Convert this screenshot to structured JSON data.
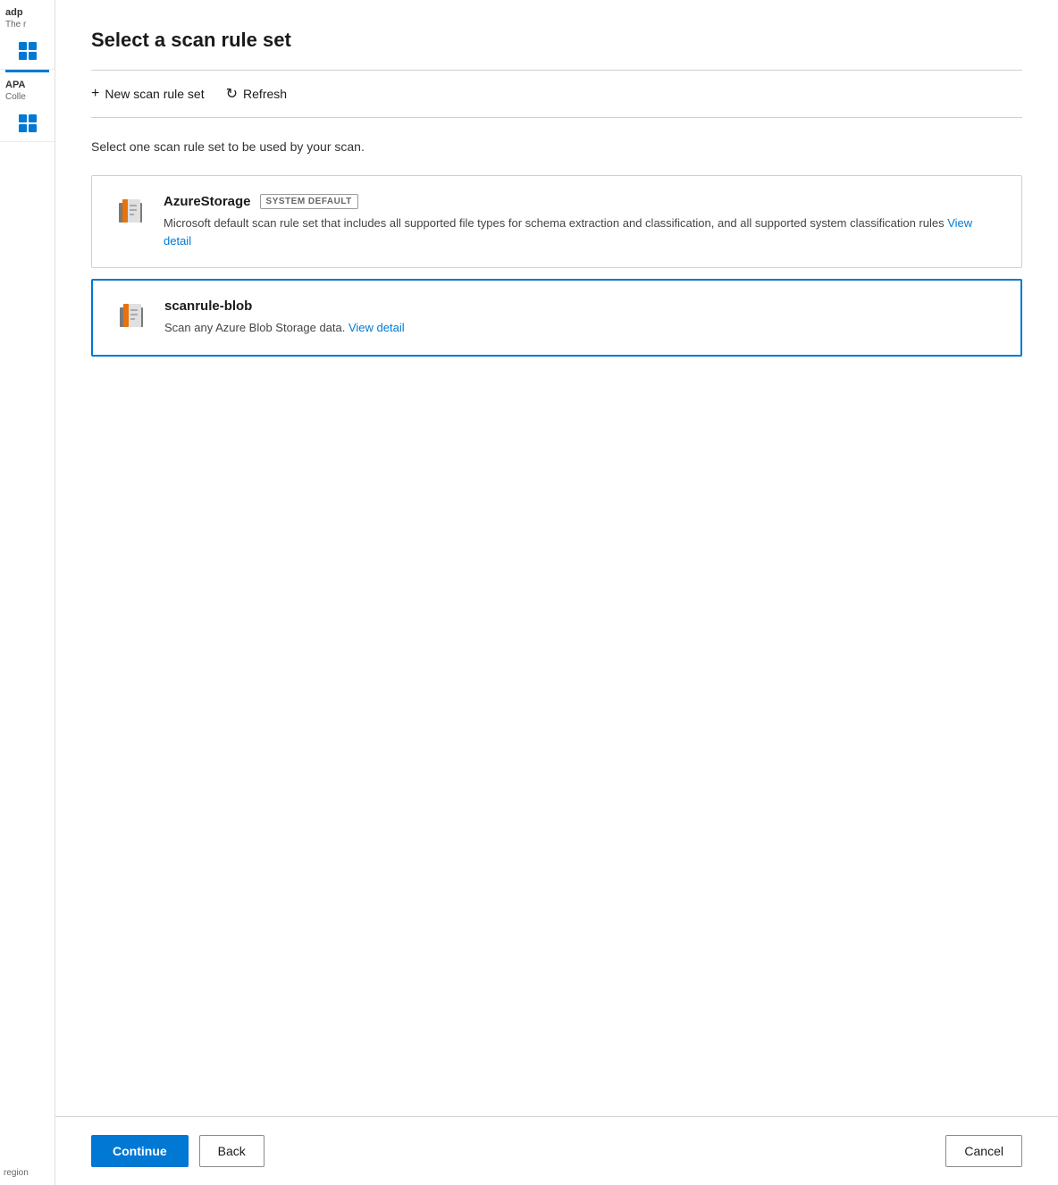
{
  "panel": {
    "title": "Select a scan rule set",
    "description": "Select one scan rule set to be used by your scan."
  },
  "toolbar": {
    "new_label": "New scan rule set",
    "refresh_label": "Refresh"
  },
  "rule_sets": [
    {
      "id": "azure-storage",
      "name": "AzureStorage",
      "badge": "SYSTEM DEFAULT",
      "description": "Microsoft default scan rule set that includes all supported file types for schema extraction and classification, and all supported system classification rules",
      "view_detail_text": "View detail",
      "selected": false
    },
    {
      "id": "scanrule-blob",
      "name": "scanrule-blob",
      "badge": "",
      "description": "Scan any Azure Blob Storage data.",
      "view_detail_text": "View detail",
      "selected": true
    }
  ],
  "footer": {
    "continue_label": "Continue",
    "back_label": "Back",
    "cancel_label": "Cancel"
  },
  "sidebar": {
    "section1": {
      "title": "adp",
      "subtitle": "The r"
    },
    "section2": {
      "title": "APA",
      "subtitle": "Colle"
    },
    "region_label": "region"
  }
}
